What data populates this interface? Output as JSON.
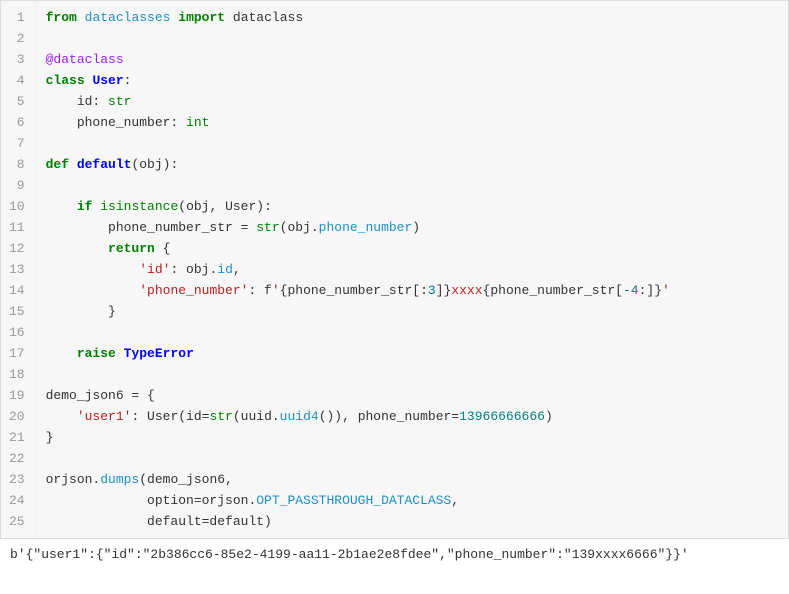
{
  "code": {
    "lines": [
      {
        "n": "1",
        "tokens": [
          [
            "from",
            "k-keyword"
          ],
          [
            " ",
            "k-plain"
          ],
          [
            "dataclasses",
            "k-attr"
          ],
          [
            " ",
            "k-plain"
          ],
          [
            "import",
            "k-keyword"
          ],
          [
            " ",
            "k-plain"
          ],
          [
            "dataclass",
            "k-plain"
          ]
        ]
      },
      {
        "n": "2",
        "tokens": []
      },
      {
        "n": "3",
        "tokens": [
          [
            "@dataclass",
            "k-decorator"
          ]
        ]
      },
      {
        "n": "4",
        "tokens": [
          [
            "class",
            "k-keyword"
          ],
          [
            " ",
            "k-plain"
          ],
          [
            "User",
            "k-class"
          ],
          [
            ":",
            "k-plain"
          ]
        ]
      },
      {
        "n": "5",
        "tokens": [
          [
            "    id: ",
            "k-plain"
          ],
          [
            "str",
            "k-builtin"
          ]
        ]
      },
      {
        "n": "6",
        "tokens": [
          [
            "    phone_number: ",
            "k-plain"
          ],
          [
            "int",
            "k-builtin"
          ]
        ]
      },
      {
        "n": "7",
        "tokens": []
      },
      {
        "n": "8",
        "tokens": [
          [
            "def",
            "k-keyword"
          ],
          [
            " ",
            "k-plain"
          ],
          [
            "default",
            "k-class"
          ],
          [
            "(obj):",
            "k-plain"
          ]
        ]
      },
      {
        "n": "9",
        "tokens": []
      },
      {
        "n": "10",
        "tokens": [
          [
            "    ",
            "k-plain"
          ],
          [
            "if",
            "k-keyword"
          ],
          [
            " ",
            "k-plain"
          ],
          [
            "isinstance",
            "k-builtin"
          ],
          [
            "(obj, User):",
            "k-plain"
          ]
        ]
      },
      {
        "n": "11",
        "tokens": [
          [
            "        phone_number_str = ",
            "k-plain"
          ],
          [
            "str",
            "k-builtin"
          ],
          [
            "(obj.",
            "k-plain"
          ],
          [
            "phone_number",
            "k-attr"
          ],
          [
            ")",
            "k-plain"
          ]
        ]
      },
      {
        "n": "12",
        "tokens": [
          [
            "        ",
            "k-plain"
          ],
          [
            "return",
            "k-keyword"
          ],
          [
            " {",
            "k-plain"
          ]
        ]
      },
      {
        "n": "13",
        "tokens": [
          [
            "            ",
            "k-plain"
          ],
          [
            "'id'",
            "k-string"
          ],
          [
            ": obj.",
            "k-plain"
          ],
          [
            "id",
            "k-attr"
          ],
          [
            ",",
            "k-plain"
          ]
        ]
      },
      {
        "n": "14",
        "tokens": [
          [
            "            ",
            "k-plain"
          ],
          [
            "'phone_number'",
            "k-string"
          ],
          [
            ": f",
            "k-plain"
          ],
          [
            "'",
            "k-string"
          ],
          [
            "{phone_number_str[:",
            "k-plain"
          ],
          [
            "3",
            "k-number"
          ],
          [
            "]}",
            "k-plain"
          ],
          [
            "xxxx",
            "k-string"
          ],
          [
            "{phone_number_str[",
            "k-plain"
          ],
          [
            "-4",
            "k-number"
          ],
          [
            ":]}",
            "k-plain"
          ],
          [
            "'",
            "k-string"
          ]
        ]
      },
      {
        "n": "15",
        "tokens": [
          [
            "        }",
            "k-plain"
          ]
        ]
      },
      {
        "n": "16",
        "tokens": []
      },
      {
        "n": "17",
        "tokens": [
          [
            "    ",
            "k-plain"
          ],
          [
            "raise",
            "k-keyword"
          ],
          [
            " ",
            "k-plain"
          ],
          [
            "TypeError",
            "k-class"
          ]
        ]
      },
      {
        "n": "18",
        "tokens": []
      },
      {
        "n": "19",
        "tokens": [
          [
            "demo_json6 = {",
            "k-plain"
          ]
        ]
      },
      {
        "n": "20",
        "tokens": [
          [
            "    ",
            "k-plain"
          ],
          [
            "'user1'",
            "k-string"
          ],
          [
            ": User(id=",
            "k-plain"
          ],
          [
            "str",
            "k-builtin"
          ],
          [
            "(uuid.",
            "k-plain"
          ],
          [
            "uuid4",
            "k-attr"
          ],
          [
            "()), phone_number=",
            "k-plain"
          ],
          [
            "13966666666",
            "k-number"
          ],
          [
            ")",
            "k-plain"
          ]
        ]
      },
      {
        "n": "21",
        "tokens": [
          [
            "}",
            "k-plain"
          ]
        ]
      },
      {
        "n": "22",
        "tokens": []
      },
      {
        "n": "23",
        "tokens": [
          [
            "orjson.",
            "k-plain"
          ],
          [
            "dumps",
            "k-attr"
          ],
          [
            "(demo_json6,",
            "k-plain"
          ]
        ]
      },
      {
        "n": "24",
        "tokens": [
          [
            "             option=orjson.",
            "k-plain"
          ],
          [
            "OPT_PASSTHROUGH_DATACLASS",
            "k-attr"
          ],
          [
            ",",
            "k-plain"
          ]
        ]
      },
      {
        "n": "25",
        "tokens": [
          [
            "             default=default)",
            "k-plain"
          ]
        ]
      }
    ]
  },
  "output": "b'{\"user1\":{\"id\":\"2b386cc6-85e2-4199-aa11-2b1ae2e8fdee\",\"phone_number\":\"139xxxx6666\"}}'"
}
